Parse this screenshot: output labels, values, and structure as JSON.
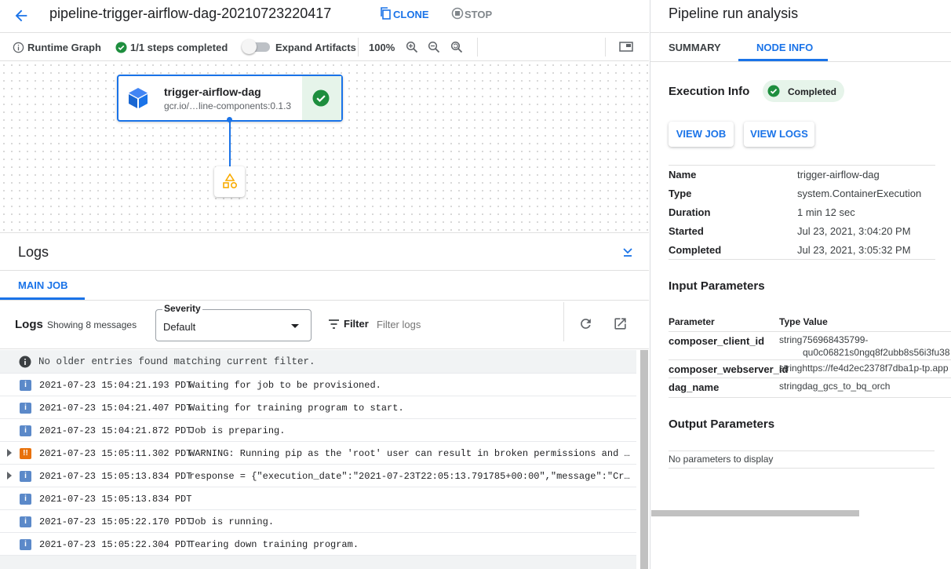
{
  "header": {
    "title": "pipeline-trigger-airflow-dag-20210723220417",
    "clone_label": "CLONE",
    "stop_label": "STOP"
  },
  "toolbar": {
    "runtime_graph_label": "Runtime Graph",
    "steps_completed": "1/1 steps completed",
    "expand_artifacts_label": "Expand Artifacts",
    "zoom_level": "100%"
  },
  "graph": {
    "node_title": "trigger-airflow-dag",
    "node_subtitle": "gcr.io/…line-components:0.1.3"
  },
  "logs": {
    "panel_title": "Logs",
    "tab_main_job": "MAIN JOB",
    "label": "Logs",
    "showing": "Showing 8 messages",
    "severity_label": "Severity",
    "severity_value": "Default",
    "filter_label": "Filter",
    "filter_placeholder": "Filter logs",
    "no_older": "No older entries found matching current filter.",
    "entries": [
      {
        "ts": "2021-07-23 15:04:21.193 PDT",
        "msg": "Waiting for job to be provisioned.",
        "level": "info",
        "expandable": false
      },
      {
        "ts": "2021-07-23 15:04:21.407 PDT",
        "msg": "Waiting for training program to start.",
        "level": "info",
        "expandable": false
      },
      {
        "ts": "2021-07-23 15:04:21.872 PDT",
        "msg": "Job is preparing.",
        "level": "info",
        "expandable": false
      },
      {
        "ts": "2021-07-23 15:05:11.302 PDT",
        "msg": "WARNING: Running pip as the 'root' user can result in broken permissions and conflic…",
        "level": "warn",
        "expandable": true
      },
      {
        "ts": "2021-07-23 15:05:13.834 PDT",
        "msg": "response = {\"execution_date\":\"2021-07-23T22:05:13.791785+00:00\",\"message\":\"Created <…",
        "level": "info",
        "expandable": true
      },
      {
        "ts": "2021-07-23 15:05:13.834 PDT",
        "msg": "",
        "level": "info",
        "expandable": false
      },
      {
        "ts": "2021-07-23 15:05:22.170 PDT",
        "msg": "Job is running.",
        "level": "info",
        "expandable": false
      },
      {
        "ts": "2021-07-23 15:05:22.304 PDT",
        "msg": "Tearing down training program.",
        "level": "info",
        "expandable": false
      }
    ]
  },
  "right": {
    "title": "Pipeline run analysis",
    "tab_summary": "SUMMARY",
    "tab_node_info": "NODE INFO",
    "execution_info_label": "Execution Info",
    "status": "Completed",
    "view_job": "VIEW JOB",
    "view_logs": "VIEW LOGS",
    "info": [
      {
        "label": "Name",
        "value": "trigger-airflow-dag"
      },
      {
        "label": "Type",
        "value": "system.ContainerExecution"
      },
      {
        "label": "Duration",
        "value": "1 min 12 sec"
      },
      {
        "label": "Started",
        "value": "Jul 23, 2021, 3:04:20 PM"
      },
      {
        "label": "Completed",
        "value": "Jul 23, 2021, 3:05:32 PM"
      }
    ],
    "input_params_title": "Input Parameters",
    "param_col": "Parameter",
    "type_value_col": "Type Value",
    "params": [
      {
        "name": "composer_client_id",
        "value1": "string756968435799-",
        "value2": "qu0c06821s0ngq8f2ubb8s56i3fu38"
      },
      {
        "name": "composer_webserver_id",
        "value1": "stringhttps://fe4d2ec2378f7dba1p-tp.app",
        "value2": ""
      },
      {
        "name": "dag_name",
        "value1": "stringdag_gcs_to_bq_orch",
        "value2": ""
      }
    ],
    "output_params_title": "Output Parameters",
    "no_params": "No parameters to display"
  },
  "colors": {
    "accent": "#1a73e8",
    "success": "#1e8e3e",
    "warning": "#e8710a",
    "info_icon": "#5b89c9"
  }
}
